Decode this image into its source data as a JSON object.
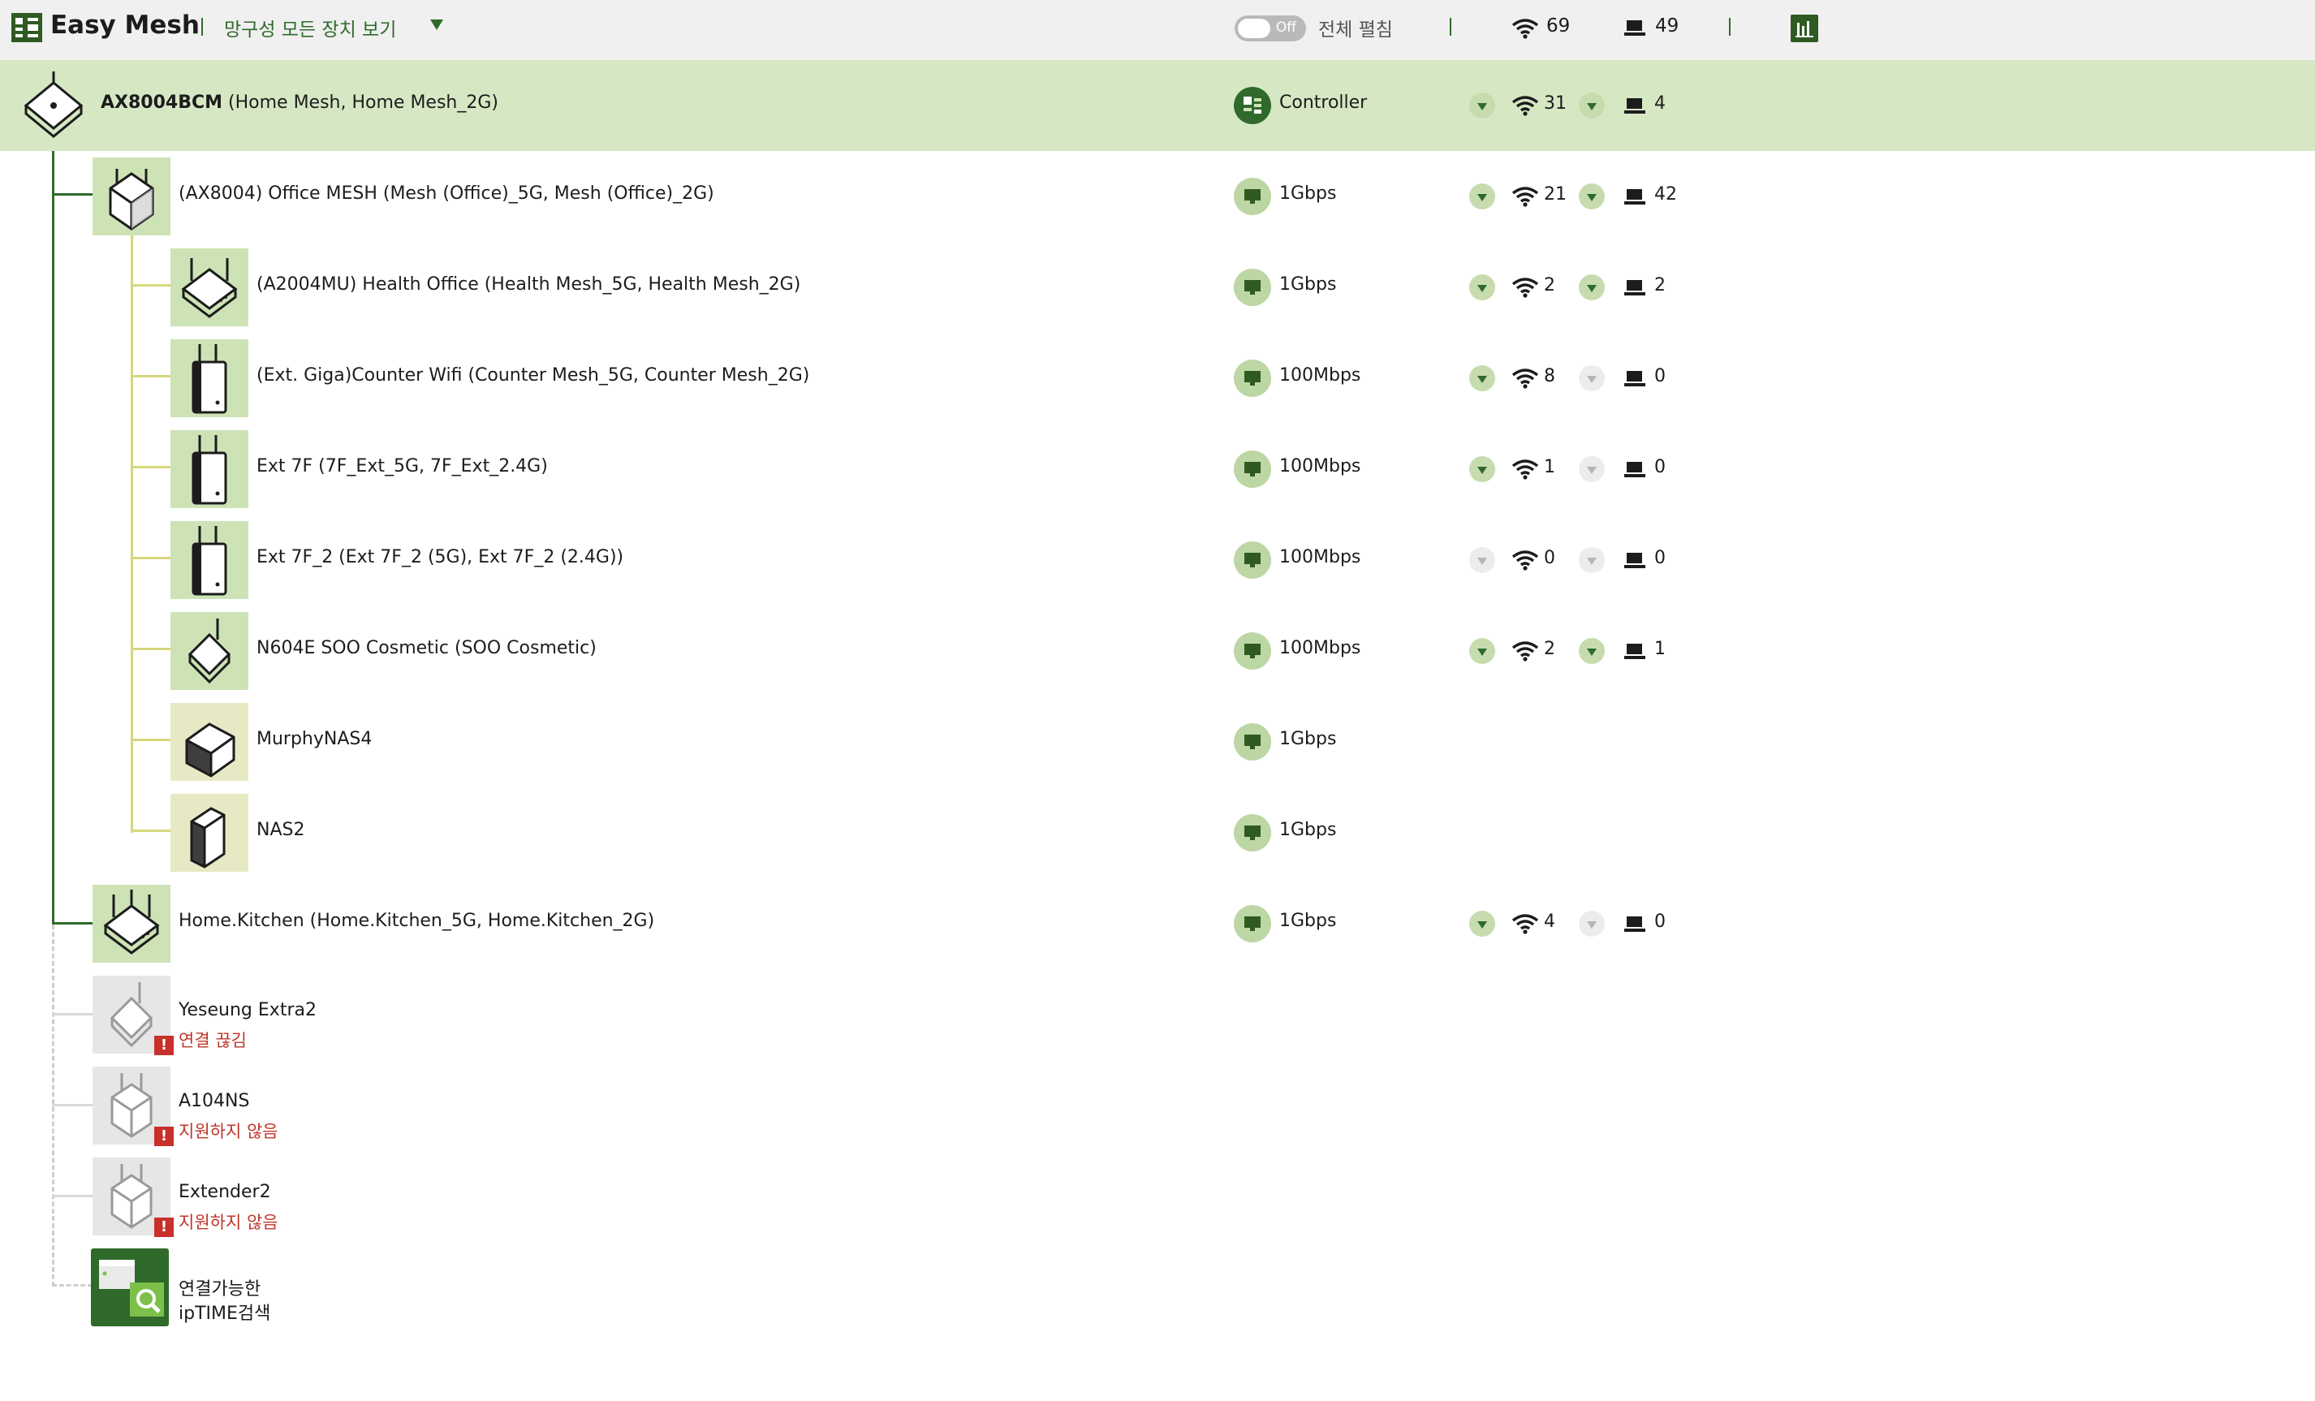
{
  "header": {
    "app_title": "Easy Mesh",
    "view_select": "망구성 모든 장치 보기",
    "toggle_state": "Off",
    "expand_all_label": "전체 펼침",
    "wifi_total": "69",
    "wired_total": "49"
  },
  "controller": {
    "name": "AX8004BCM",
    "ssids": "(Home Mesh, Home Mesh_2G)",
    "role": "Controller",
    "wifi_count": "31",
    "wired_count": "4"
  },
  "devices": [
    {
      "label": "(AX8004) Office MESH  (Mesh (Office)_5G, Mesh (Office)_2G)",
      "link": "1Gbps",
      "wifi": "21",
      "wired": "42"
    },
    {
      "label": "(A2004MU) Health Office  (Health Mesh_5G, Health Mesh_2G)",
      "link": "1Gbps",
      "wifi": "2",
      "wired": "2"
    },
    {
      "label": "(Ext. Giga)Counter Wifi  (Counter Mesh_5G, Counter Mesh_2G)",
      "link": "100Mbps",
      "wifi": "8",
      "wired": "0"
    },
    {
      "label": "Ext 7F  (7F_Ext_5G, 7F_Ext_2.4G)",
      "link": "100Mbps",
      "wifi": "1",
      "wired": "0"
    },
    {
      "label": "Ext 7F_2  (Ext 7F_2 (5G), Ext 7F_2 (2.4G))",
      "link": "100Mbps",
      "wifi": "0",
      "wired": "0"
    },
    {
      "label": "N604E SOO Cosmetic  (SOO Cosmetic)",
      "link": "100Mbps",
      "wifi": "2",
      "wired": "1"
    },
    {
      "label": "MurphyNAS4",
      "link": "1Gbps"
    },
    {
      "label": "NAS2",
      "link": "1Gbps"
    },
    {
      "label": "Home.Kitchen  (Home.Kitchen_5G, Home.Kitchen_2G)",
      "link": "1Gbps",
      "wifi": "4",
      "wired": "0"
    }
  ],
  "offline_devices": [
    {
      "label": "Yeseung Extra2",
      "status": "연결 끊김"
    },
    {
      "label": "A104NS",
      "status": "지원하지 않음"
    },
    {
      "label": "Extender2",
      "status": "지원하지 않음"
    }
  ],
  "search_item": {
    "line1": "연결가능한",
    "line2": "ipTIME검색"
  },
  "colors": {
    "accent": "#2f6a2a",
    "controller_bg": "#d6e8c3",
    "error": "#c0352b"
  },
  "icons": [
    "easy-mesh-logo-icon",
    "wifi-icon",
    "wired-pc-icon",
    "ethernet-icon",
    "stats-chart-icon",
    "router-icon",
    "extender-icon",
    "nas-icon",
    "alert-icon",
    "search-icon"
  ]
}
